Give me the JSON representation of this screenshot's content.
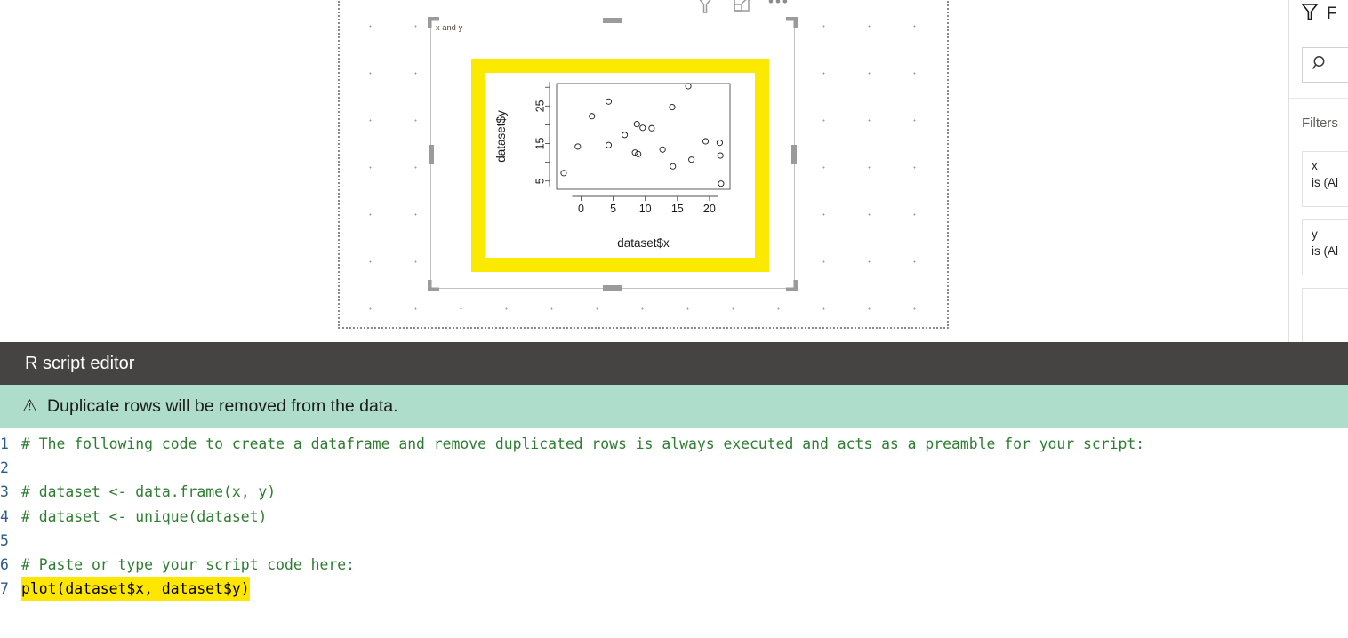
{
  "visual": {
    "title": "x and y",
    "toolbar": [
      {
        "name": "filter-icon",
        "label": "Filters"
      },
      {
        "name": "focus-mode-icon",
        "label": "Focus mode"
      },
      {
        "name": "more-options-icon",
        "label": "More options"
      }
    ]
  },
  "filters_pane": {
    "title": "F",
    "search_placeholder": "",
    "section_label": "Filters ",
    "cards": [
      {
        "name": "x",
        "state": "is (Al"
      },
      {
        "name": "y",
        "state": "is (Al"
      },
      {
        "name": "",
        "state": ""
      }
    ]
  },
  "editor": {
    "title": "R script editor",
    "warning": "Duplicate rows will be removed from the data.",
    "warning_icon": "⚠",
    "lines": [
      {
        "n": "1",
        "text": "# The following code to create a dataframe and remove duplicated rows is always executed and acts as a preamble for your script:",
        "highlight": false
      },
      {
        "n": "2",
        "text": "",
        "highlight": false
      },
      {
        "n": "3",
        "text": "# dataset <- data.frame(x, y)",
        "highlight": false
      },
      {
        "n": "4",
        "text": "# dataset <- unique(dataset)",
        "highlight": false
      },
      {
        "n": "5",
        "text": "",
        "highlight": false
      },
      {
        "n": "6",
        "text": "# Paste or type your script code here:",
        "highlight": false
      },
      {
        "n": "7",
        "text": "plot(dataset$x, dataset$y)",
        "highlight": true
      }
    ]
  },
  "colors": {
    "highlight_yellow": "#fbe900",
    "code_highlight": "#ffe600",
    "editor_header": "#464442",
    "warning_bg": "#aeddcb",
    "comment_green": "#2e7d32",
    "line_number_blue": "#2b5a8f"
  },
  "chart_data": {
    "type": "scatter",
    "title": "",
    "xlabel": "dataset$x",
    "ylabel": "dataset$y",
    "xticks": [
      0,
      5,
      10,
      15,
      20
    ],
    "yticks": [
      5,
      15,
      25
    ],
    "yticks_minor": [
      10,
      20,
      30
    ],
    "xlim": [
      -3.8,
      23.2
    ],
    "ylim": [
      2.8,
      31.0
    ],
    "grid": false,
    "legend": null,
    "marker": "open-circle",
    "points": [
      {
        "x": -2.7,
        "y": 7.1
      },
      {
        "x": -0.5,
        "y": 14.2
      },
      {
        "x": 1.7,
        "y": 22.3
      },
      {
        "x": 4.3,
        "y": 26.2
      },
      {
        "x": 4.3,
        "y": 14.6
      },
      {
        "x": 6.8,
        "y": 17.3
      },
      {
        "x": 8.4,
        "y": 12.6
      },
      {
        "x": 8.7,
        "y": 20.2
      },
      {
        "x": 8.9,
        "y": 12.2
      },
      {
        "x": 9.6,
        "y": 19.2
      },
      {
        "x": 11.0,
        "y": 19.1
      },
      {
        "x": 12.7,
        "y": 13.4
      },
      {
        "x": 14.3,
        "y": 8.9
      },
      {
        "x": 14.2,
        "y": 24.7
      },
      {
        "x": 16.7,
        "y": 30.3
      },
      {
        "x": 17.2,
        "y": 10.7
      },
      {
        "x": 19.4,
        "y": 15.6
      },
      {
        "x": 21.6,
        "y": 15.2
      },
      {
        "x": 21.7,
        "y": 11.8
      },
      {
        "x": 21.8,
        "y": 4.3
      }
    ]
  }
}
